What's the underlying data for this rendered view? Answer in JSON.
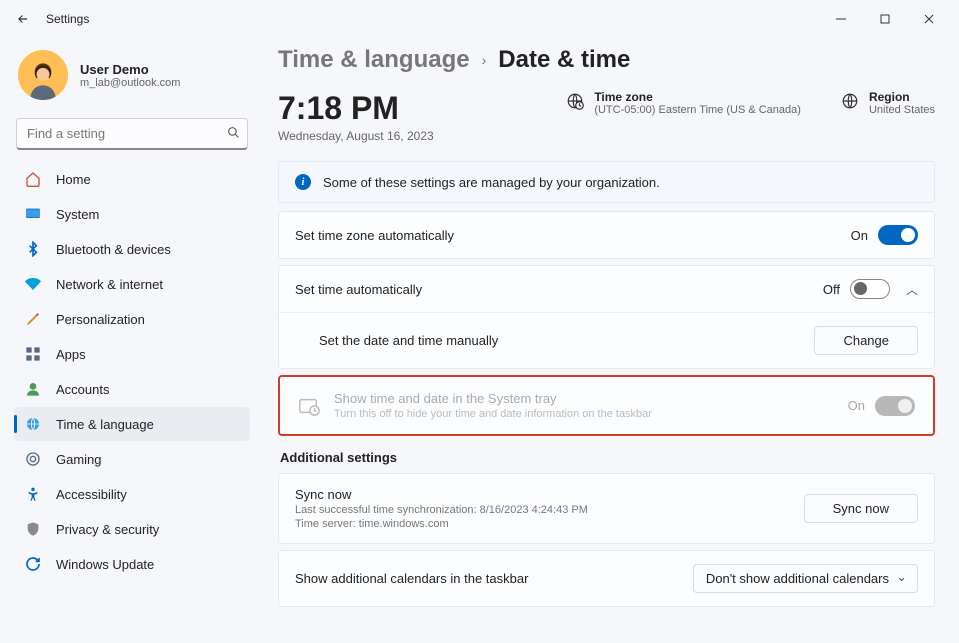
{
  "window": {
    "title": "Settings"
  },
  "profile": {
    "name": "User Demo",
    "email": "m_lab@outlook.com"
  },
  "search": {
    "placeholder": "Find a setting"
  },
  "sidebar": {
    "items": [
      {
        "label": "Home"
      },
      {
        "label": "System"
      },
      {
        "label": "Bluetooth & devices"
      },
      {
        "label": "Network & internet"
      },
      {
        "label": "Personalization"
      },
      {
        "label": "Apps"
      },
      {
        "label": "Accounts"
      },
      {
        "label": "Time & language"
      },
      {
        "label": "Gaming"
      },
      {
        "label": "Accessibility"
      },
      {
        "label": "Privacy & security"
      },
      {
        "label": "Windows Update"
      }
    ]
  },
  "breadcrumb": {
    "parent": "Time & language",
    "current": "Date & time"
  },
  "clock": {
    "time": "7:18 PM",
    "date": "Wednesday, August 16, 2023"
  },
  "timezone": {
    "label": "Time zone",
    "value": "(UTC-05:00) Eastern Time (US & Canada)"
  },
  "region": {
    "label": "Region",
    "value": "United States"
  },
  "banner": {
    "text": "Some of these settings are managed by your organization."
  },
  "settings": {
    "tz_auto": {
      "label": "Set time zone automatically",
      "state": "On"
    },
    "time_auto": {
      "label": "Set time automatically",
      "state": "Off"
    },
    "manual": {
      "label": "Set the date and time manually",
      "button": "Change"
    },
    "systray": {
      "label": "Show time and date in the System tray",
      "sub": "Turn this off to hide your time and date information on the taskbar",
      "state": "On"
    }
  },
  "additional": {
    "heading": "Additional settings",
    "sync": {
      "title": "Sync now",
      "line1": "Last successful time synchronization: 8/16/2023 4:24:43 PM",
      "line2": "Time server: time.windows.com",
      "button": "Sync now"
    },
    "calendars": {
      "label": "Show additional calendars in the taskbar",
      "selected": "Don't show additional calendars"
    }
  }
}
